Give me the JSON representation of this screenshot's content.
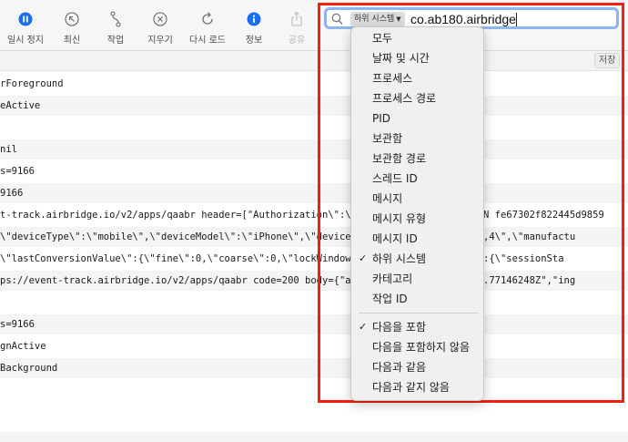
{
  "toolbar": {
    "pause_label": "일시 정지",
    "latest_label": "최신",
    "activities_label": "작업",
    "clear_label": "지우기",
    "reload_label": "다시 로드",
    "info_label": "정보",
    "share_label": "공유",
    "accent_color": "#1a6ef0"
  },
  "search": {
    "token_label": "하위 시스템",
    "query": "co.ab180.airbridge"
  },
  "subbar": {
    "save_label": "저장"
  },
  "log_rows": [
    "rForeground",
    "eActive",
    "",
    "nil",
    "s=9166",
    "9166",
    "t-track.airbridge.io/v2/apps/qaabr header=[\"Authorization\\\":\\\"AIRBRIDGE-API-KEY-TOKEN fe67302f822445d9859",
    "\\\"deviceType\\\":\\\"mobile\\\",\\\"deviceModel\\\":\\\"iPhone\\\",\\\"deviceIdentifier\\\":\\\"iPhone10,4\\\",\\\"manufactu",
    "\\\"lastConversionValue\\\":{\\\"fine\\\":0,\\\"coarse\\\":0,\\\"lockWindow\\\":false},\\\"eventData\\\":{\\\"sessionSta",
    "ps://event-track.airbridge.io/v2/apps/qaabr code=200 body={\"at\":\"2021-09-28T06:01:28.77146248Z\",\"ing",
    "",
    "s=9166",
    "gnActive",
    "Background"
  ],
  "menu": {
    "groups": [
      [
        "모두",
        "날짜 및 시간",
        "프로세스",
        "프로세스 경로",
        "PID",
        "보관함",
        "보관함 경로",
        "스레드 ID",
        "메시지",
        "메시지 유형",
        "메시지 ID",
        "하위 시스템",
        "카테고리",
        "작업 ID"
      ],
      [
        "다음을 포함",
        "다음을 포함하지 않음",
        "다음과 같음",
        "다음과 같지 않음"
      ]
    ],
    "checked": [
      "하위 시스템",
      "다음을 포함"
    ],
    "check_glyph": "✓"
  },
  "highlight_color": "#f0220e"
}
